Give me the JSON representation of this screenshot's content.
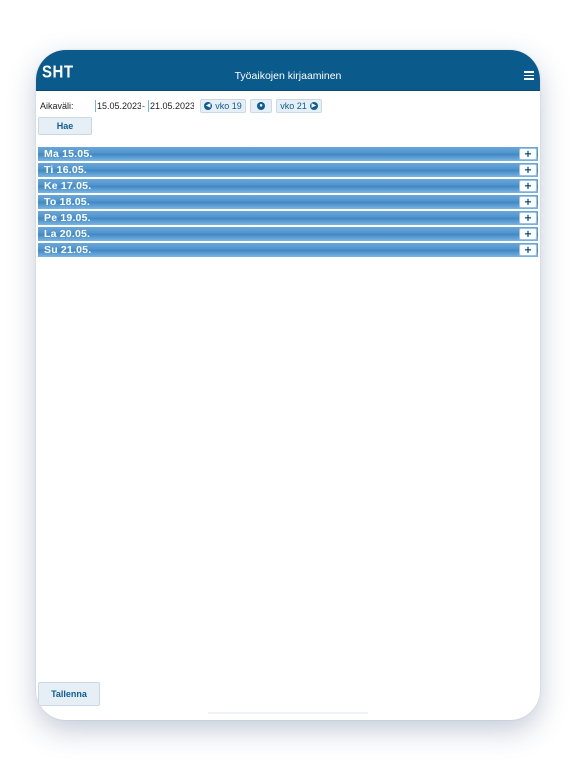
{
  "header": {
    "logo": "SHT",
    "title": "Työaikojen kirjaaminen"
  },
  "filter": {
    "range_label": "Aikaväli:",
    "start_date": "15.05.2023",
    "separator": "-",
    "end_date": "21.05.2023",
    "prev_week_label": "vko 19",
    "next_week_label": "vko 21",
    "search_label": "Hae"
  },
  "days": [
    {
      "label": "Ma  15.05."
    },
    {
      "label": "Ti   16.05."
    },
    {
      "label": "Ke  17.05."
    },
    {
      "label": "To  18.05."
    },
    {
      "label": "Pe  19.05."
    },
    {
      "label": "La  20.05."
    },
    {
      "label": "Su  21.05."
    }
  ],
  "add_label": "+",
  "footer": {
    "save_label": "Tallenna"
  },
  "colors": {
    "header": "#0a5a8c",
    "day_row": "#4f93cc",
    "button_text": "#0d5d92"
  },
  "icons": {
    "menu": "hamburger-menu-icon",
    "prev": "arrow-left-circle-icon",
    "current": "dot-circle-icon",
    "next": "arrow-right-circle-icon",
    "add": "plus-icon"
  }
}
